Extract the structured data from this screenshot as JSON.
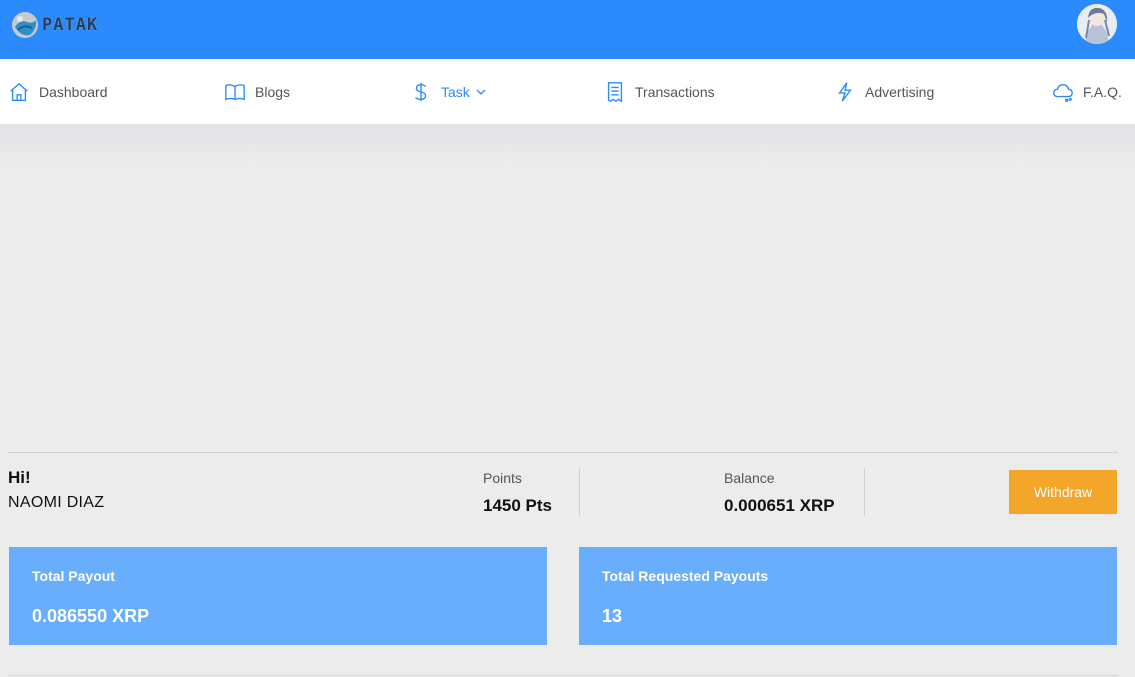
{
  "header": {
    "logo_text": "PATAK",
    "brand_color": "#2b8afc",
    "avatar_icon": "user-avatar"
  },
  "nav": {
    "items": [
      {
        "label": "Dashboard",
        "icon": "home-icon",
        "active": false
      },
      {
        "label": "Blogs",
        "icon": "book-icon",
        "active": false
      },
      {
        "label": "Task",
        "icon": "dollar-icon",
        "active": true,
        "has_dropdown": true
      },
      {
        "label": "Transactions",
        "icon": "receipt-icon",
        "active": false
      },
      {
        "label": "Advertising",
        "icon": "lightning-icon",
        "active": false
      },
      {
        "label": "F.A.Q.",
        "icon": "cloud-chat-icon",
        "active": false
      }
    ]
  },
  "user": {
    "greeting": "Hi!",
    "name": "NAOMI DIAZ"
  },
  "stats": {
    "points_label": "Points",
    "points_value": "1450 Pts",
    "balance_label": "Balance",
    "balance_value": "0.000651 XRP"
  },
  "withdraw_label": "Withdraw",
  "withdraw_color": "#f4a62a",
  "cards": [
    {
      "title": "Total Payout",
      "value": "0.086550 XRP"
    },
    {
      "title": "Total Requested Payouts",
      "value": "13"
    }
  ],
  "card_color": "#69aefc"
}
